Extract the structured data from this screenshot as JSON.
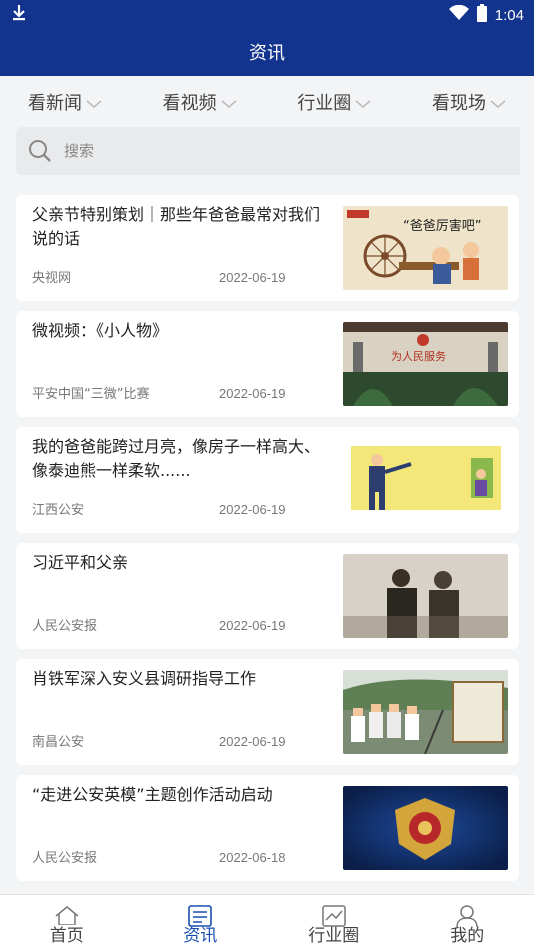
{
  "status_bar": {
    "time": "1:04"
  },
  "app_bar": {
    "title": "资讯"
  },
  "category_tabs": [
    {
      "label": "看新闻"
    },
    {
      "label": "看视频"
    },
    {
      "label": "行业圈"
    },
    {
      "label": "看现场"
    }
  ],
  "search": {
    "placeholder": "搜索"
  },
  "news": [
    {
      "title": "父亲节特别策划｜那些年爸爸最常对我们说的话",
      "source": "央视网",
      "date": "2022-06-19"
    },
    {
      "title": "微视频：《小人物》",
      "source": "平安中国“三微”比赛",
      "date": "2022-06-19"
    },
    {
      "title": "我的爸爸能跨过月亮，像房子一样高大、像泰迪熊一样柔软......",
      "source": "江西公安",
      "date": "2022-06-19"
    },
    {
      "title": "习近平和父亲",
      "source": "人民公安报",
      "date": "2022-06-19"
    },
    {
      "title": "肖铁军深入安义县调研指导工作",
      "source": "南昌公安",
      "date": "2022-06-19"
    },
    {
      "title": "“走进公安英模”主题创作活动启动",
      "source": "人民公安报",
      "date": "2022-06-18"
    }
  ],
  "thumb_text": {
    "t1_caption": "“爸爸厉害吧”",
    "t2_sign": "为人民服务"
  },
  "bottom_nav": [
    {
      "label": "首页",
      "icon": "home-icon"
    },
    {
      "label": "资讯",
      "icon": "news-icon"
    },
    {
      "label": "行业圈",
      "icon": "chart-icon"
    },
    {
      "label": "我的",
      "icon": "person-icon"
    }
  ],
  "colors": {
    "primary": "#12338e",
    "active": "#1a4fb0"
  }
}
